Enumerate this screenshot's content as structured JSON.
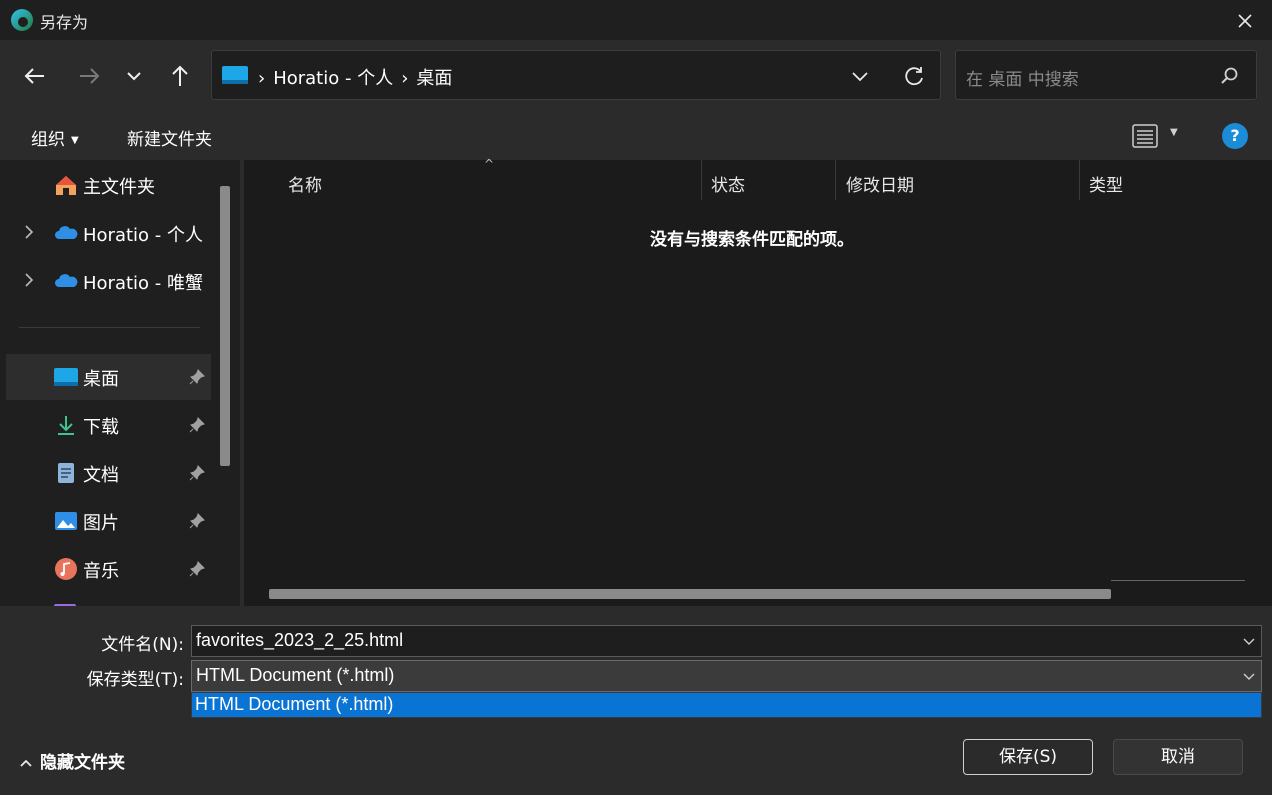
{
  "window": {
    "title": "另存为"
  },
  "address": {
    "location": "Horatio - 个人",
    "current": "桌面"
  },
  "search": {
    "placeholder": "在 桌面 中搜索"
  },
  "toolbar": {
    "organize": "组织",
    "new_folder": "新建文件夹",
    "help": "?"
  },
  "sidebar": {
    "items": [
      {
        "label": "主文件夹",
        "icon": "home-icon"
      },
      {
        "label": "Horatio - 个人",
        "icon": "onedrive-icon"
      },
      {
        "label": "Horatio - 唯蟹",
        "icon": "onedrive-icon"
      },
      {
        "label": "桌面",
        "icon": "desktop-icon"
      },
      {
        "label": "下载",
        "icon": "download-icon"
      },
      {
        "label": "文档",
        "icon": "document-icon"
      },
      {
        "label": "图片",
        "icon": "pictures-icon"
      },
      {
        "label": "音乐",
        "icon": "music-icon"
      }
    ]
  },
  "columns": {
    "name": "名称",
    "status": "状态",
    "modified": "修改日期",
    "type": "类型"
  },
  "main": {
    "empty_message": "没有与搜索条件匹配的项。"
  },
  "form": {
    "filename_label": "文件名(N):",
    "filename_value": "favorites_2023_2_25.html",
    "filetype_label": "保存类型(T):",
    "filetype_value": "HTML Document (*.html)",
    "filetype_options": [
      "HTML Document (*.html)"
    ]
  },
  "footer": {
    "hide_folders": "隐藏文件夹",
    "save": "保存(S)",
    "cancel": "取消"
  },
  "colors": {
    "accent": "#0a74d4",
    "background": "#202020"
  }
}
